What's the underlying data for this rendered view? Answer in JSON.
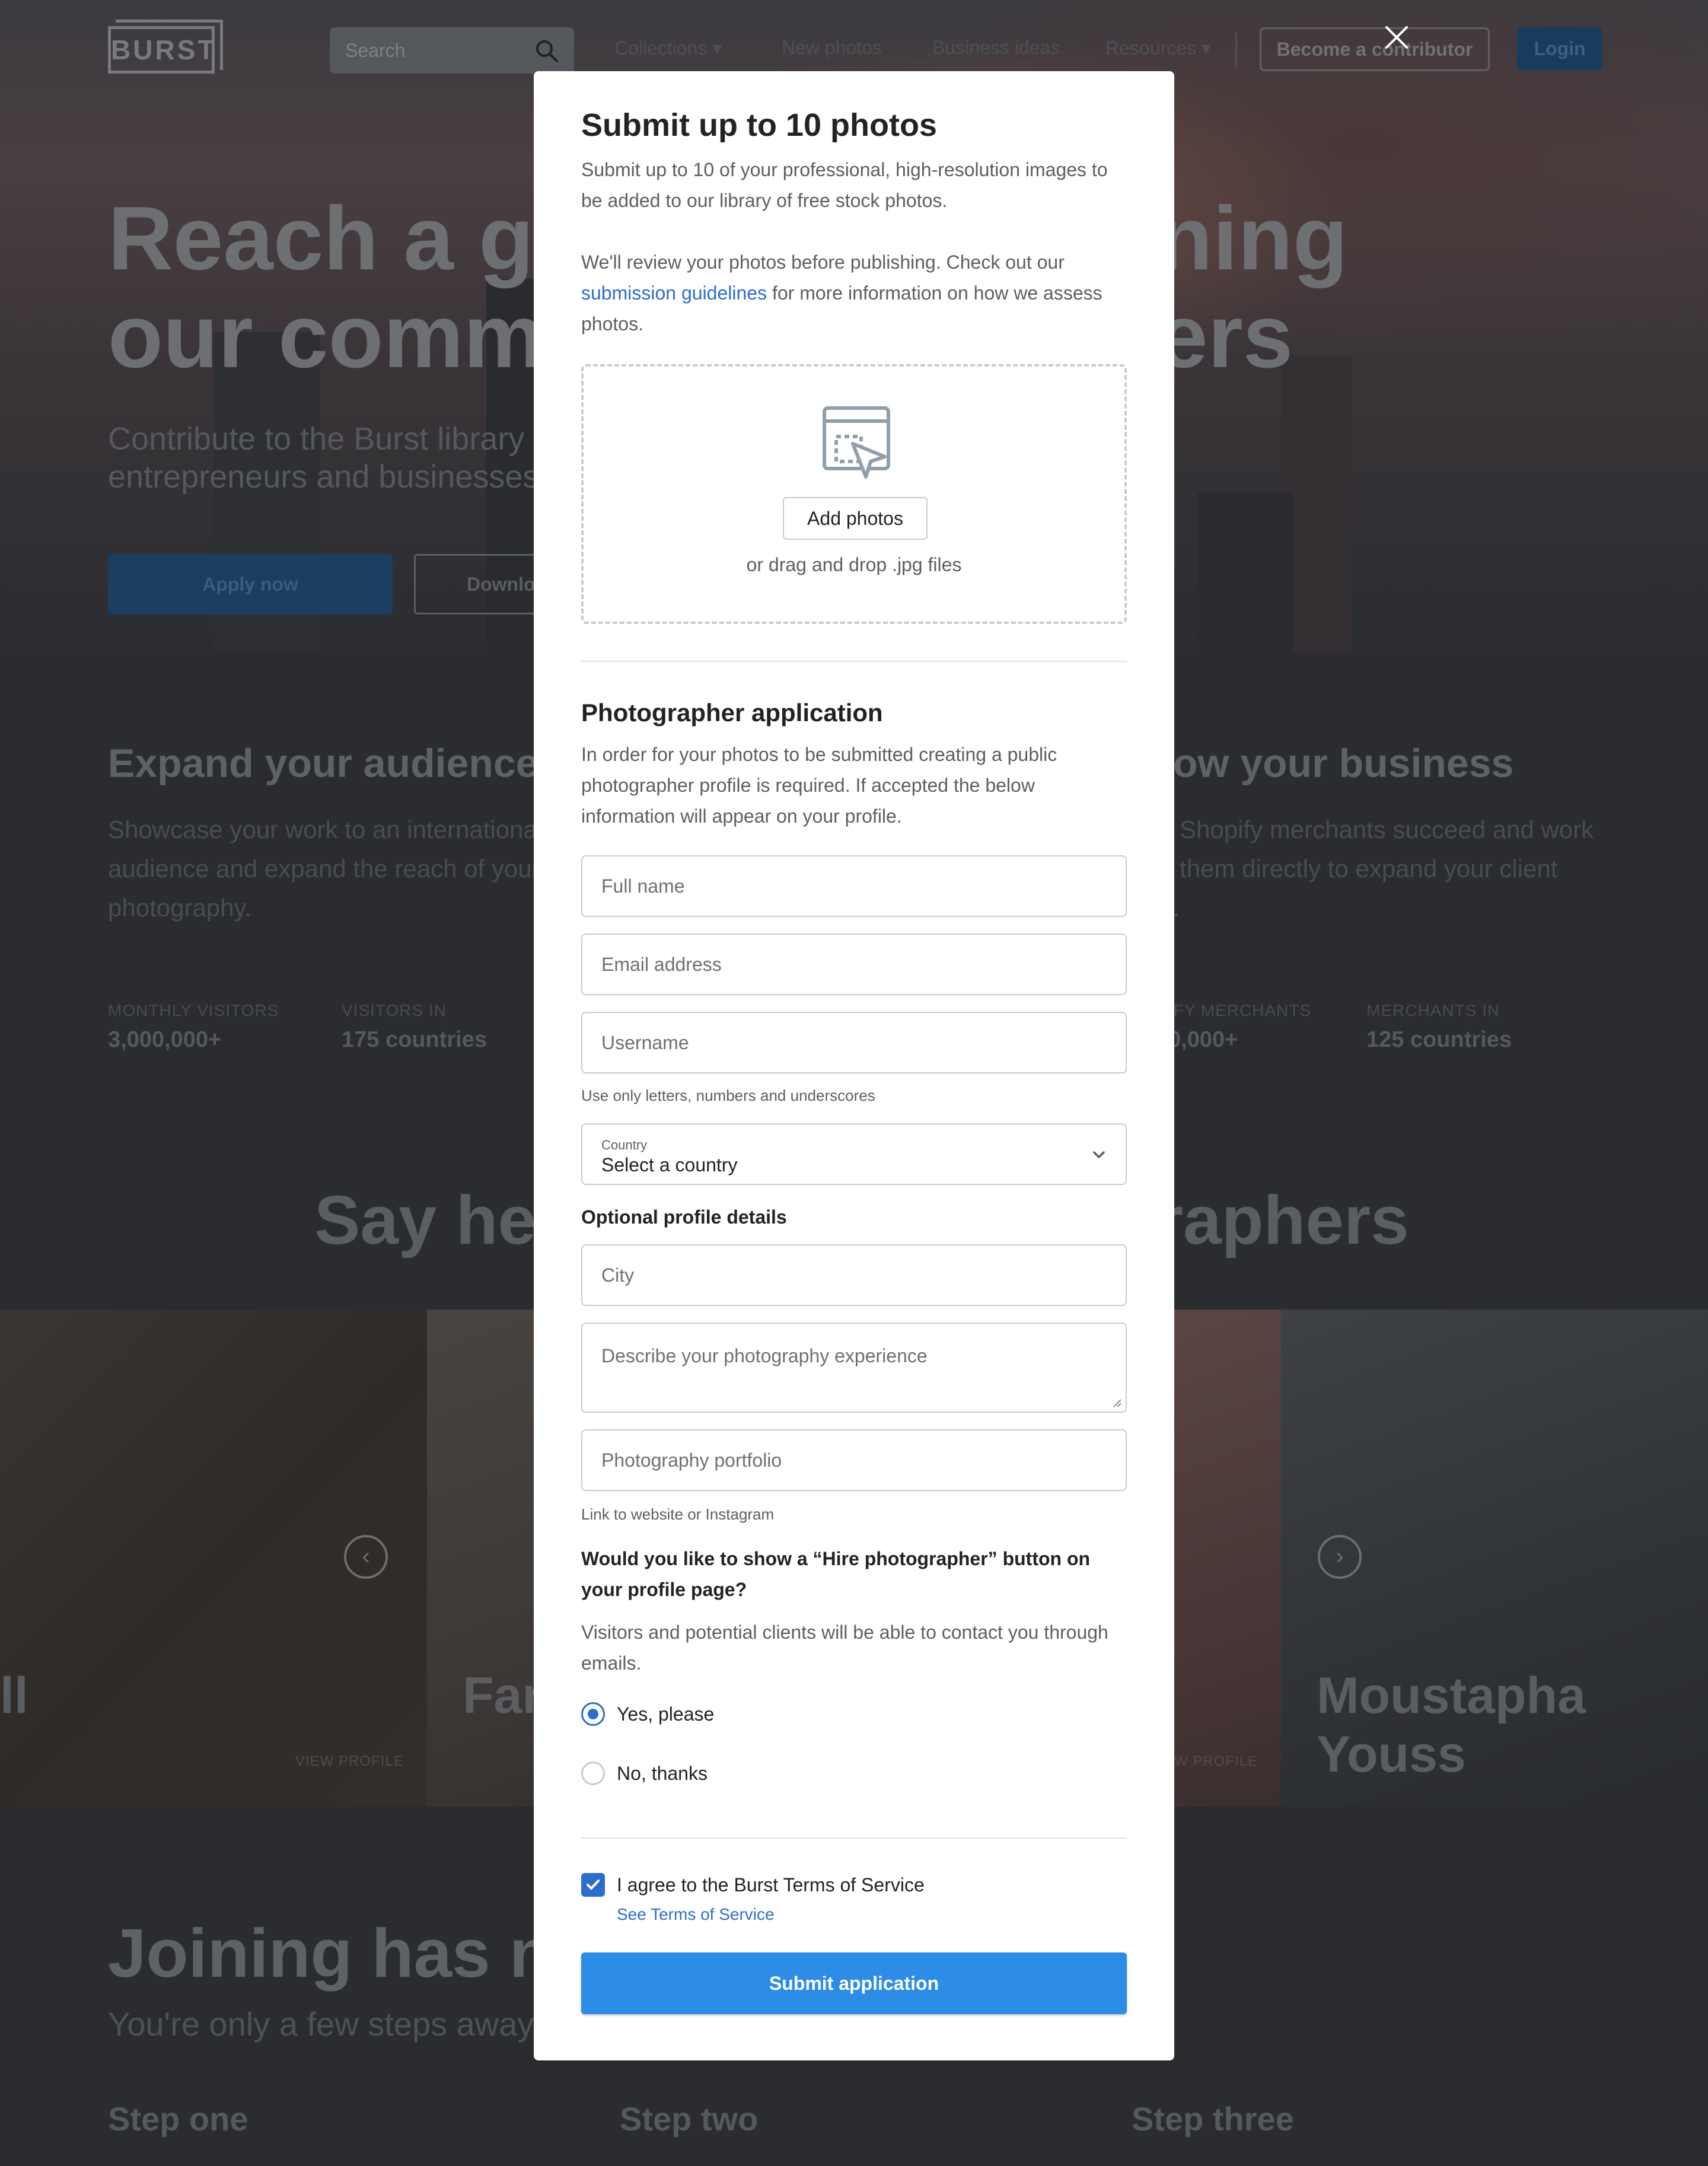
{
  "nav": {
    "logo": "BURST",
    "search_placeholder": "Search",
    "collections": "Collections",
    "new_photos": "New photos",
    "business_ideas": "Business ideas",
    "resources": "Resources",
    "become_contributor": "Become a contributor",
    "login": "Login"
  },
  "hero": {
    "title_line1_left": "Reach a glob",
    "title_line1_right": "ning",
    "title_line2_left": "our commun",
    "title_line2_right": "ers",
    "subtitle_line1": "Contribute to the Burst library",
    "subtitle_line2": "entrepreneurs and businesses",
    "apply_button": "Apply now",
    "download_button": "Downlo"
  },
  "features": {
    "left_title": "Expand your audience",
    "left_text_1": "Showcase your work to an internationa",
    "left_text_2": "audience and expand the reach of your",
    "left_text_3": "photography.",
    "right_title": "ow your business",
    "right_text_1": "p Shopify merchants succeed and work",
    "right_text_2": "h them directly to expand your client",
    "right_text_3": "e.",
    "stats": [
      {
        "label": "MONTHLY VISITORS",
        "value": "3,000,000+"
      },
      {
        "label": "VISITORS IN",
        "value": "175 countries"
      },
      {
        "label": "IFY MERCHANTS",
        "value": "0,000+"
      },
      {
        "label": "MERCHANTS IN",
        "value": "125 countries"
      }
    ]
  },
  "photographers": {
    "heading_left": "Say hell",
    "heading_right": "raphers",
    "name_left": "ll",
    "name_mid": "Far",
    "name_right": "Moustapha Youss",
    "view_profile_left": "VIEW PROFILE",
    "view_profile_right": "W PROFILE",
    "prev_arrow": "‹",
    "next_arrow": "›"
  },
  "joining": {
    "title": "Joining has neve",
    "subtitle": "You're only a few steps away",
    "steps": [
      "Step one",
      "Step two",
      "Step three"
    ]
  },
  "modal": {
    "title": "Submit up to 10 photos",
    "intro_1": "Submit up to 10 of your professional, high-resolution images to be added to our library of free stock photos.",
    "intro_2_before": "We'll review your photos before publishing. Check out our ",
    "intro_2_link": "submission guidelines",
    "intro_2_after": " for more information on how we assess photos.",
    "add_photos_button": "Add photos",
    "drop_caption": "or drag and drop .jpg files",
    "application_title": "Photographer application",
    "application_text": "In order for your photos to be submitted creating a public photographer profile is required. If accepted the below information will appear on your profile.",
    "full_name_placeholder": "Full name",
    "email_placeholder": "Email address",
    "username_placeholder": "Username",
    "username_hint": "Use only letters, numbers and underscores",
    "country_label": "Country",
    "country_value": "Select a country",
    "optional_title": "Optional profile details",
    "city_placeholder": "City",
    "experience_placeholder": "Describe your photography experience",
    "portfolio_placeholder": "Photography portfolio",
    "portfolio_hint": "Link to website or Instagram",
    "hire_question": "Would you like to show a “Hire photographer” button on your profile page?",
    "hire_text": "Visitors and potential clients will be able to contact you through emails.",
    "radio_yes": "Yes, please",
    "radio_no": "No, thanks",
    "selected_radio": "yes",
    "agree_checked": true,
    "agree_label": "I agree to the Burst Terms of Service",
    "terms_link": "See Terms of Service",
    "submit_button": "Submit application"
  },
  "colors": {
    "primary_blue": "#2c8ce6",
    "link_blue": "#2c6ecb",
    "overlay": "#2d2f33"
  }
}
